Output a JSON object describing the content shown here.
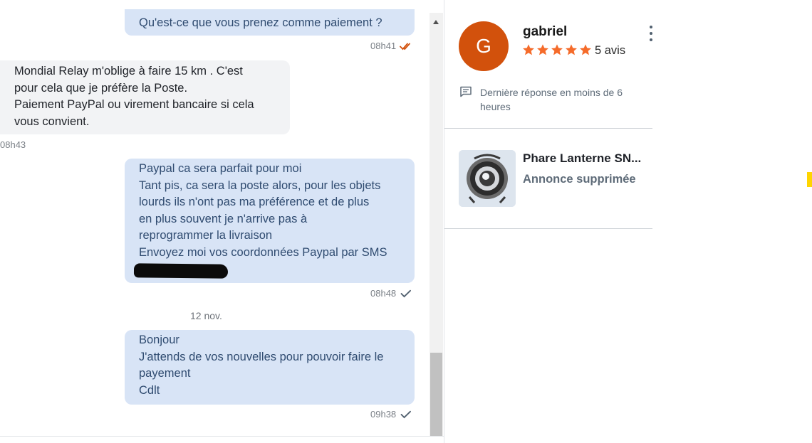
{
  "conversation": {
    "messages": [
      {
        "direction": "outgoing",
        "lines": [
          "Qu'est-ce que vous prenez comme paiement ?"
        ],
        "time": "08h41",
        "status": "read"
      },
      {
        "direction": "incoming",
        "lines": [
          "Mondial Relay m'oblige à faire 15 km . C'est",
          "pour cela que je préfère la Poste.",
          "Paiement PayPal ou virement bancaire si cela",
          "vous convient."
        ],
        "time": "08h43"
      },
      {
        "direction": "outgoing",
        "lines": [
          "Paypal ca sera parfait pour moi",
          "Tant pis, ca sera la poste alors, pour les objets",
          "lourds ils n'ont pas ma préférence et de plus",
          "en plus souvent je n'arrive pas à",
          "reprogrammer la livraison",
          "Envoyez moi vos coordonnées Paypal par SMS"
        ],
        "time": "08h48",
        "status": "sent"
      },
      {
        "direction": "outgoing",
        "lines": [
          "Bonjour",
          "J'attends de vos nouvelles pour pouvoir faire le",
          "payement",
          "Cdlt"
        ],
        "time": "09h38",
        "status": "sent"
      }
    ],
    "date_separator": "12 nov."
  },
  "seller": {
    "avatar_letter": "G",
    "avatar_color": "#d2510c",
    "name": "gabriel",
    "rating_stars": 5,
    "star_color": "#f56b2a",
    "review_count": "5 avis",
    "response_time": "Dernière réponse en moins de 6 heures"
  },
  "listing": {
    "title": "Phare Lanterne SN...",
    "status": "Annonce supprimée"
  },
  "icons": {
    "read_receipt": "double-check-icon",
    "sent_receipt": "check-icon",
    "response_time": "message-icon",
    "menu": "more-vertical-icon",
    "scroll_up": "arrow-up-icon"
  },
  "colors": {
    "outgoing_bubble": "#d8e4f6",
    "incoming_bubble": "#f2f3f5",
    "read_check": "#d2510c",
    "sent_check": "#51606f"
  }
}
